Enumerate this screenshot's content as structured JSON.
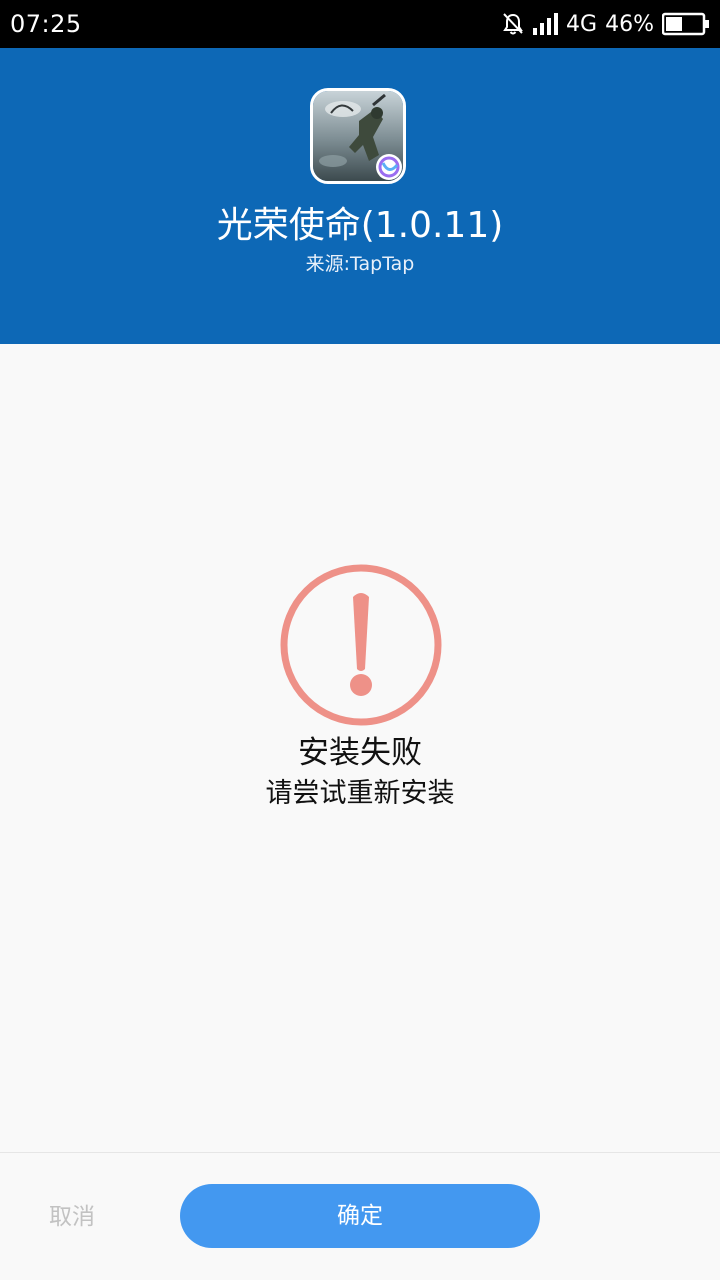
{
  "status_bar": {
    "time": "07:25",
    "network": "4G",
    "battery": "46%",
    "battery_level": 0.46,
    "icons": [
      "bell-off-icon",
      "signal-icon",
      "battery-icon"
    ]
  },
  "app": {
    "icon": "app-game-icon",
    "title": "光荣使命(1.0.11)",
    "source": "来源:TapTap"
  },
  "result": {
    "icon": "error-exclamation-icon",
    "title": "安装失败",
    "subtitle": "请尝试重新安装"
  },
  "footer": {
    "cancel_label": "取消",
    "confirm_label": "确定"
  },
  "colors": {
    "header": "#0d68b6",
    "error": "#ee9188",
    "confirm": "#4398f0",
    "cancel_text": "#c2c2c2"
  }
}
